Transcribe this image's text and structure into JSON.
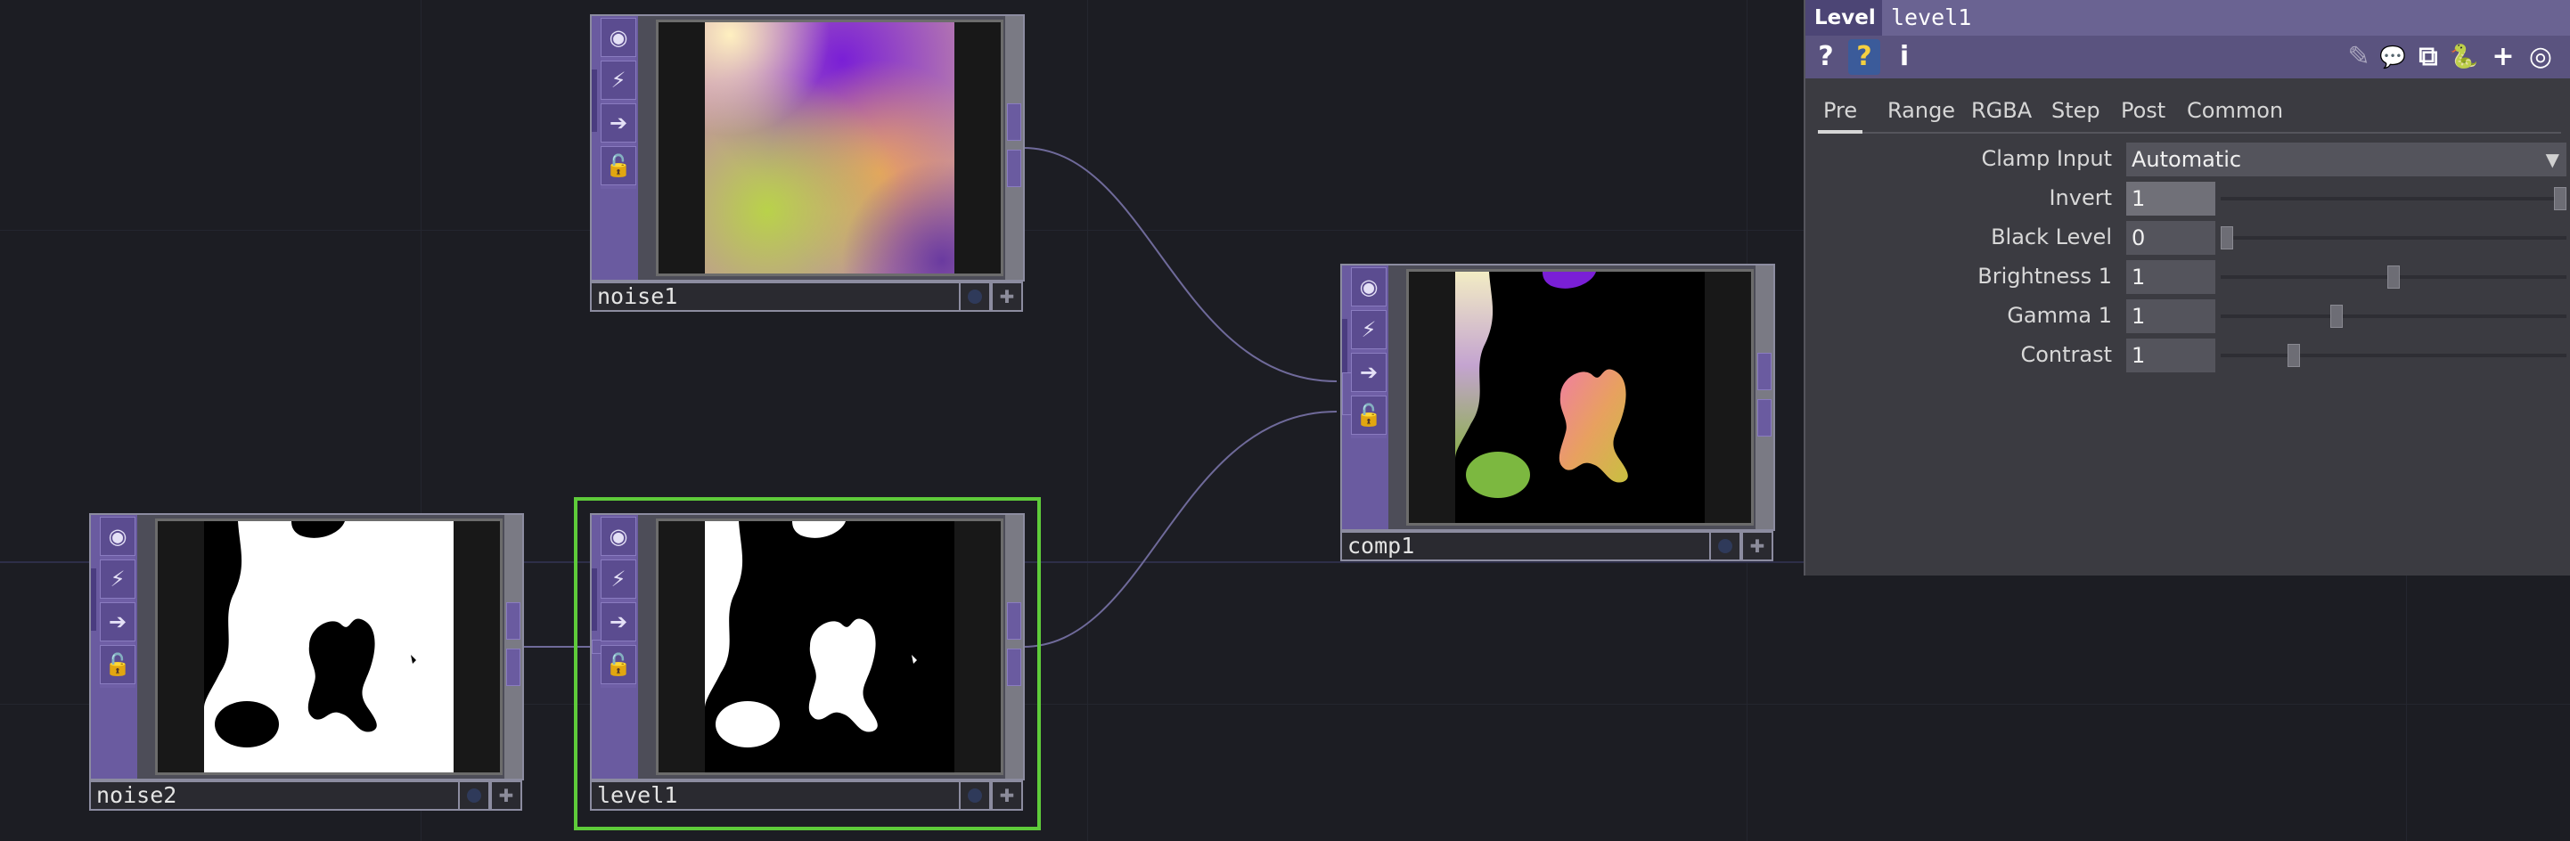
{
  "nodes": {
    "noise1": {
      "label": "noise1"
    },
    "noise2": {
      "label": "noise2"
    },
    "level1": {
      "label": "level1"
    },
    "comp1": {
      "label": "comp1"
    }
  },
  "op_icons": {
    "viewer": "◉",
    "cook": "⚡",
    "export": "➔",
    "lock": "🔓"
  },
  "panel": {
    "op_type": "Level",
    "op_name": "level1",
    "toolbar": {
      "help": "?",
      "python_help": "?",
      "info": "i",
      "edit": "✎",
      "comment": "💬",
      "clone": "⧉",
      "python": "🐍",
      "add": "+",
      "target": "◎"
    },
    "tabs": [
      "Pre",
      "Range",
      "RGBA",
      "Step",
      "Post",
      "Common"
    ],
    "active_tab": "Pre",
    "clamp_input": {
      "label": "Clamp Input",
      "value": "Automatic"
    },
    "params": [
      {
        "label": "Invert",
        "value": "1",
        "slider": 1.0
      },
      {
        "label": "Black Level",
        "value": "0",
        "slider": 0.0
      },
      {
        "label": "Brightness 1",
        "value": "1",
        "slider": 0.5
      },
      {
        "label": "Gamma 1",
        "value": "1",
        "slider": 0.33
      },
      {
        "label": "Contrast",
        "value": "1",
        "slider": 0.2
      }
    ]
  }
}
